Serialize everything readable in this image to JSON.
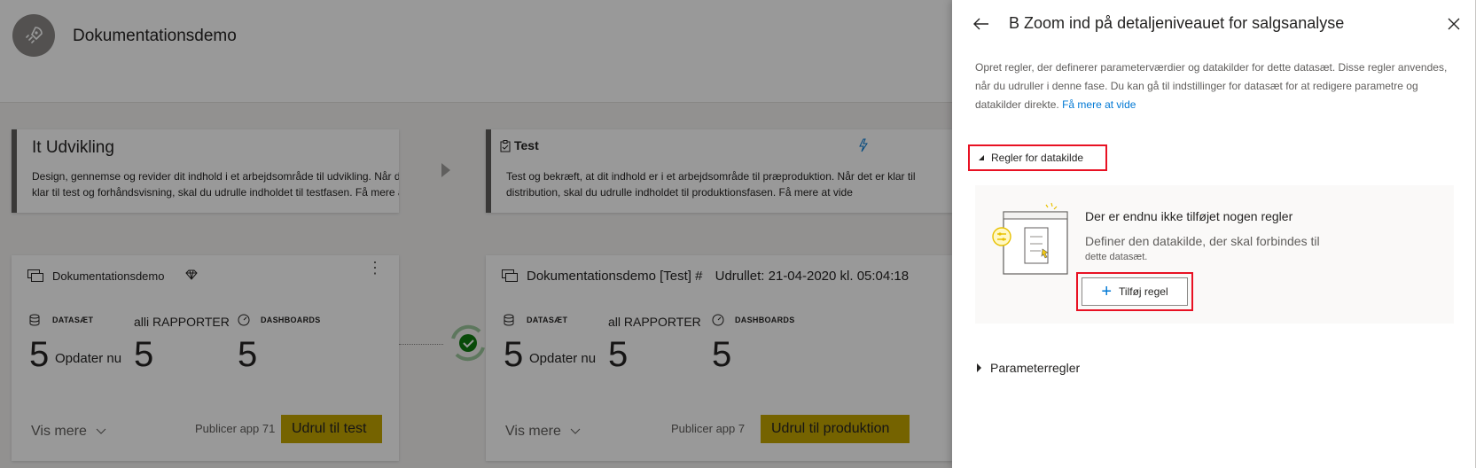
{
  "workspace": {
    "title": "Dokumentationsdemo"
  },
  "stages": [
    {
      "title": "It Udvikling",
      "description_line1": "Design, gennemse og revider dit indhold i et arbejdsområde til udvikling. Når det er",
      "description_line2": "klar til test og forhåndsvisning, skal du udrulle indholdet til testfasen. Få mere at vide"
    },
    {
      "title": "Test",
      "description_line1": "Test og bekræft, at dit indhold er i et arbejdsområde til præproduktion. Når det er klar til",
      "description_line2": "distribution, skal du udrulle indholdet til produktionsfasen. Få mere at vide"
    }
  ],
  "content_cards": [
    {
      "name": "Dokumentationsdemo",
      "datasets_label": "DATASÆT",
      "datasets_count": "5",
      "refresh_label": "Opdater nu",
      "reports_label": "alli RAPPORTER",
      "reports_count": "5",
      "dashboards_label": "DASHBOARDS",
      "dashboards_count": "5",
      "show_more": "Vis mere",
      "publish_app": "Publicer app 71",
      "deploy_button": "Udrul til test"
    },
    {
      "name": "Dokumentationsdemo [Test] #",
      "deployed": "Udrullet: 21-04-2020 kl. 05:04:18",
      "datasets_label": "DATASÆT",
      "datasets_count": "5",
      "refresh_label": "Opdater nu",
      "reports_label": "all RAPPORTER",
      "reports_count": "5",
      "dashboards_label": "DASHBOARDS",
      "dashboards_count": "5",
      "show_more": "Vis mere",
      "publish_app": "Publicer app 7",
      "deploy_button": "Udrul til produktion"
    }
  ],
  "panel": {
    "title": "B Zoom ind på detaljeniveauet for salgsanalyse",
    "description": "Opret regler, der definerer parameterværdier og datakilder for dette datasæt. Disse regler anvendes, når du udruller i denne fase. Du kan gå til indstillinger for datasæt for at redigere parametre og datakilder direkte.",
    "learn_more": "Få mere at vide",
    "datasource_rules_label": "Regler for datakilde",
    "empty_title": "Der er endnu ikke tilføjet nogen regler",
    "empty_sub1": "Definer den datakilde, der skal forbindes til",
    "empty_sub2": "dette datasæt.",
    "add_rule_button": "Tilføj regel",
    "parameter_rules_label": "Parameterregler"
  },
  "colors": {
    "accent": "#0078d4",
    "highlight_box": "#e81123",
    "deploy_button": "#c3a500",
    "success": "#107c10"
  },
  "icons": [
    "rocket-icon",
    "back-arrow-icon",
    "close-icon",
    "dataset-icon",
    "dashboard-icon",
    "diamond-icon",
    "checkmark-icon",
    "chevron-down-icon",
    "plus-icon"
  ]
}
